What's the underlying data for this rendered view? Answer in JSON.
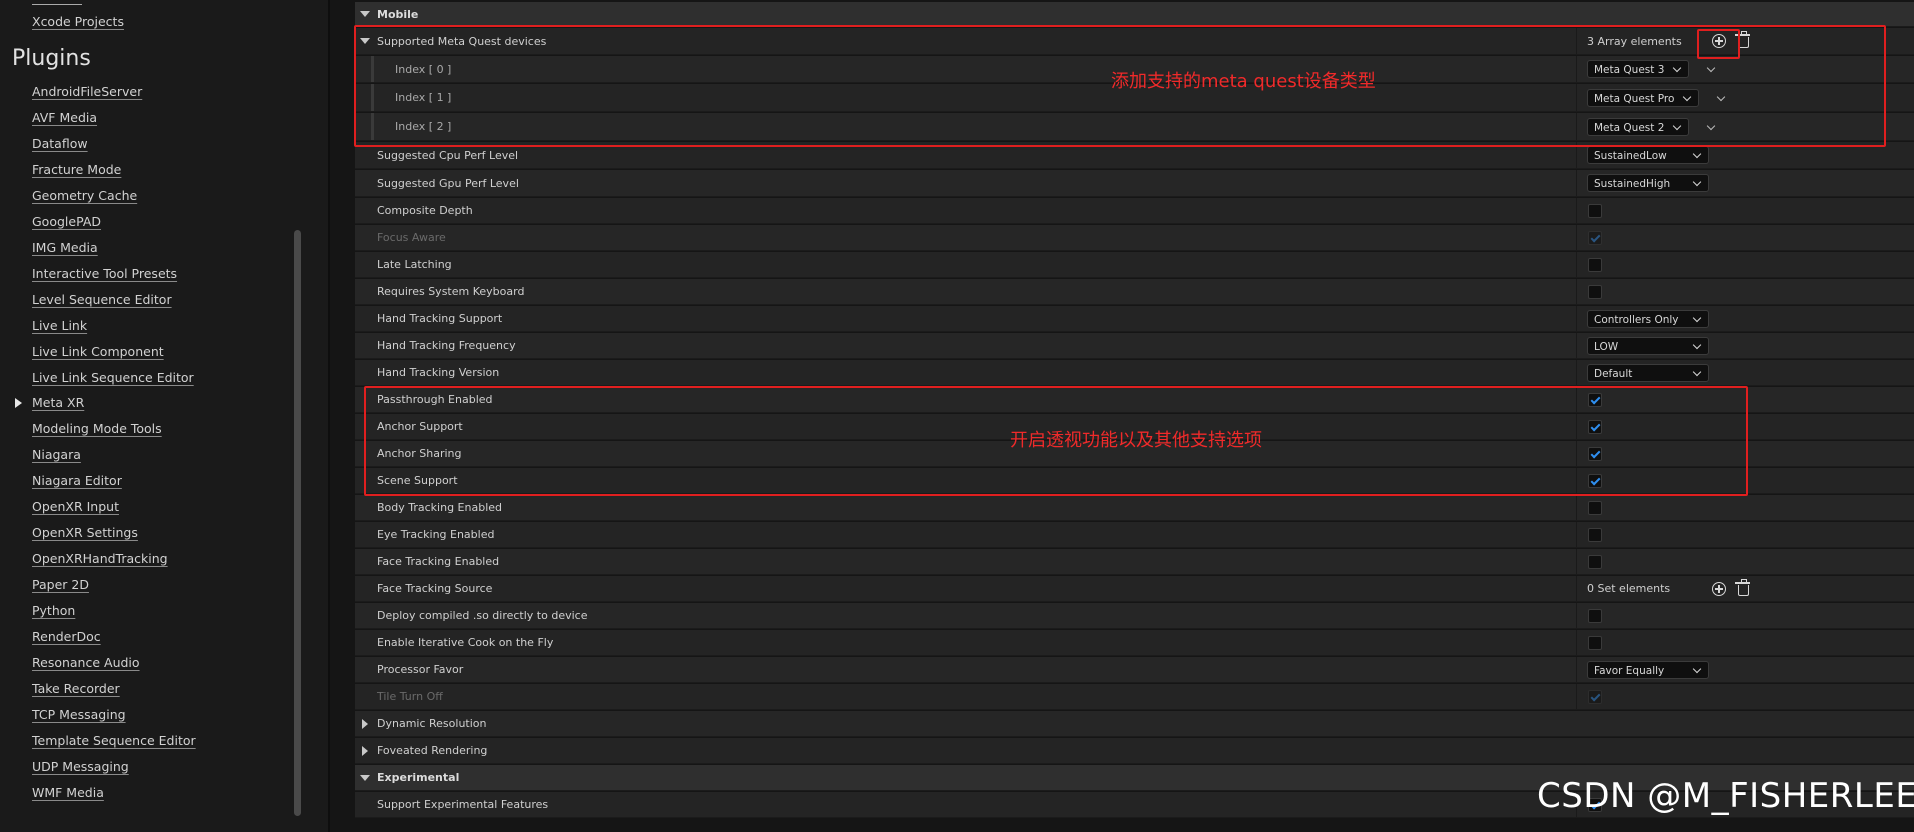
{
  "sidebar": {
    "top_item": "Xcode Projects",
    "plugins_heading": "Plugins",
    "items": [
      "AndroidFileServer",
      "AVF Media",
      "Dataflow",
      "Fracture Mode",
      "Geometry Cache",
      "GooglePAD",
      "IMG Media",
      "Interactive Tool Presets",
      "Level Sequence Editor",
      "Live Link",
      "Live Link Component",
      "Live Link Sequence Editor",
      "Meta XR",
      "Modeling Mode Tools",
      "Niagara",
      "Niagara Editor",
      "OpenXR Input",
      "OpenXR Settings",
      "OpenXRHandTracking",
      "Paper 2D",
      "Python",
      "RenderDoc",
      "Resonance Audio",
      "Take Recorder",
      "TCP Messaging",
      "Template Sequence Editor",
      "UDP Messaging",
      "WMF Media"
    ],
    "expanded_item": "Meta XR"
  },
  "settings": {
    "section_mobile": "Mobile",
    "supported_devices": {
      "label": "Supported Meta Quest devices",
      "count_text": "3 Array elements",
      "elements": [
        {
          "index": "Index [ 0 ]",
          "value": "Meta Quest 3"
        },
        {
          "index": "Index [ 1 ]",
          "value": "Meta Quest Pro"
        },
        {
          "index": "Index [ 2 ]",
          "value": "Meta Quest 2"
        }
      ]
    },
    "cpu_perf": {
      "label": "Suggested Cpu Perf Level",
      "value": "SustainedLow"
    },
    "gpu_perf": {
      "label": "Suggested Gpu Perf Level",
      "value": "SustainedHigh"
    },
    "composite_depth": {
      "label": "Composite Depth",
      "checked": false
    },
    "focus_aware": {
      "label": "Focus Aware",
      "checked": true
    },
    "late_latching": {
      "label": "Late Latching",
      "checked": false
    },
    "system_keyboard": {
      "label": "Requires System Keyboard",
      "checked": false
    },
    "hand_tracking_support": {
      "label": "Hand Tracking Support",
      "value": "Controllers Only"
    },
    "hand_tracking_frequency": {
      "label": "Hand Tracking Frequency",
      "value": "LOW"
    },
    "hand_tracking_version": {
      "label": "Hand Tracking Version",
      "value": "Default"
    },
    "passthrough": {
      "label": "Passthrough Enabled",
      "checked": true
    },
    "anchor_support": {
      "label": "Anchor Support",
      "checked": true
    },
    "anchor_sharing": {
      "label": "Anchor Sharing",
      "checked": true
    },
    "scene_support": {
      "label": "Scene Support",
      "checked": true
    },
    "body_tracking": {
      "label": "Body Tracking Enabled",
      "checked": false
    },
    "eye_tracking": {
      "label": "Eye Tracking Enabled",
      "checked": false
    },
    "face_tracking": {
      "label": "Face Tracking Enabled",
      "checked": false
    },
    "face_tracking_source": {
      "label": "Face Tracking Source",
      "count_text": "0 Set elements"
    },
    "deploy_so": {
      "label": "Deploy compiled .so directly to device",
      "checked": false
    },
    "iterative_cook": {
      "label": "Enable Iterative Cook on the Fly",
      "checked": false
    },
    "processor_favor": {
      "label": "Processor Favor",
      "value": "Favor Equally"
    },
    "tile_turn_off": {
      "label": "Tile Turn Off",
      "checked": true
    },
    "dynamic_resolution": "Dynamic Resolution",
    "foveated_rendering": "Foveated Rendering",
    "section_experimental": "Experimental",
    "experimental_features": {
      "label": "Support Experimental Features",
      "checked": true
    }
  },
  "annotations": {
    "devices_note": "添加支持的meta quest设备类型",
    "passthrough_note": "开启透视功能以及其他支持选项",
    "color": "#e01f1f"
  },
  "watermark": "CSDN @M_FISHERLEE"
}
